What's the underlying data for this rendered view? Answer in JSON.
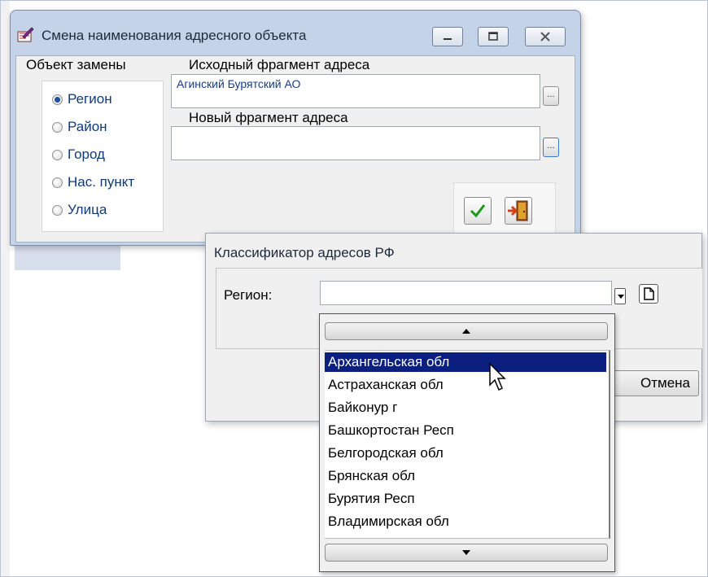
{
  "window1": {
    "title": "Смена наименования адресного объекта",
    "object_label": "Объект замены",
    "radio_options": [
      {
        "label": "Регион",
        "checked": true
      },
      {
        "label": "Район",
        "checked": false
      },
      {
        "label": "Город",
        "checked": false
      },
      {
        "label": "Нас. пункт",
        "checked": false
      },
      {
        "label": "Улица",
        "checked": false
      }
    ],
    "source_label": "Исходный фрагмент адреса",
    "source_value": "Агинский Бурятский АО",
    "new_label": "Новый фрагмент адреса",
    "new_value": "",
    "ellipsis": "..."
  },
  "window2": {
    "title": "Классификатор адресов РФ",
    "region_label": "Регион:",
    "region_value": "",
    "cancel_label": "Отмена"
  },
  "dropdown": {
    "items": [
      "Архангельская обл",
      "Астраханская обл",
      "Байконур г",
      "Башкортостан Респ",
      "Белгородская обл",
      "Брянская обл",
      "Бурятия Респ",
      "Владимирская обл"
    ],
    "selected_index": 0
  },
  "colors": {
    "title_bar": "#c5d3e8",
    "selection": "#0a1f7e",
    "radio_text": "#0f3a7a"
  }
}
